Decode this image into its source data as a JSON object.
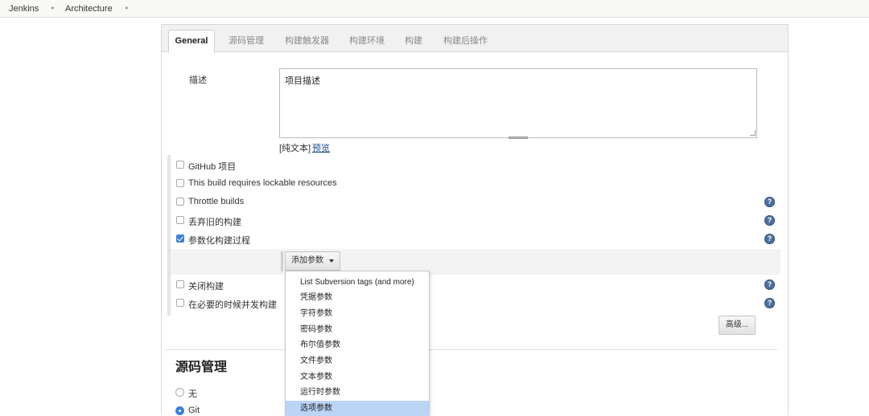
{
  "breadcrumb": {
    "items": [
      "Jenkins",
      "Architecture"
    ]
  },
  "tabs": [
    "General",
    "源码管理",
    "构建触发器",
    "构建环境",
    "构建",
    "构建后操作"
  ],
  "description": {
    "label": "描述",
    "value": "项目描述",
    "plain_text": "[纯文本]",
    "preview": "预览"
  },
  "options": [
    {
      "label": "GitHub 项目",
      "checked": false,
      "help": false
    },
    {
      "label": "This build requires lockable resources",
      "checked": false,
      "help": false
    },
    {
      "label": "Throttle builds",
      "checked": false,
      "help": true
    },
    {
      "label": "丢弃旧的构建",
      "checked": false,
      "help": true
    },
    {
      "label": "参数化构建过程",
      "checked": true,
      "help": true
    }
  ],
  "add_param_button": "添加参数",
  "options_after": [
    {
      "label": "关闭构建",
      "checked": false,
      "help": true
    },
    {
      "label": "在必要的时候并发构建",
      "checked": false,
      "help": true
    }
  ],
  "advanced_button": "高级...",
  "param_menu": {
    "items": [
      "List Subversion tags (and more)",
      "凭据参数",
      "字符参数",
      "密码参数",
      "布尔值参数",
      "文件参数",
      "文本参数",
      "运行时参数",
      "选项参数"
    ],
    "highlighted": "选项参数"
  },
  "scm": {
    "title": "源码管理",
    "options": [
      {
        "label": "无",
        "selected": false
      },
      {
        "label": "Git",
        "selected": true
      }
    ]
  },
  "help_icon": "?",
  "colors": {
    "accent": "#3d7fd6",
    "menu_highlight": "#bcd4f5",
    "help_icon": "#4e6f9c"
  }
}
